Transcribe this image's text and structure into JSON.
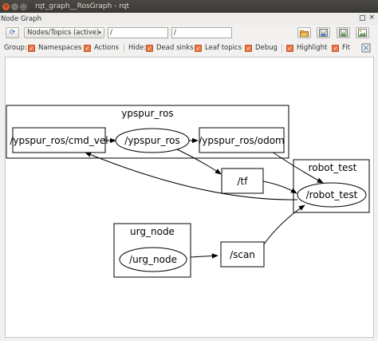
{
  "window": {
    "title": "rqt_graph__RosGraph - rqt",
    "close_glyph": "×",
    "min_glyph": "–",
    "max_glyph": "□"
  },
  "dock": {
    "title": "Node Graph"
  },
  "toolbar": {
    "refresh_glyph": "⟳",
    "mode_select": "Nodes/Topics (active)",
    "mode_arrow": "▾",
    "node_filter": "/",
    "topic_filter": "/"
  },
  "options": {
    "group_label": "Group:",
    "namespaces": {
      "label": "Namespaces",
      "checked": true
    },
    "actions": {
      "label": "Actions",
      "checked": true
    },
    "hide_label": "Hide:",
    "dead_sinks": {
      "label": "Dead sinks",
      "checked": true
    },
    "leaf_topics": {
      "label": "Leaf topics",
      "checked": true
    },
    "debug": {
      "label": "Debug",
      "checked": true
    },
    "highlight": {
      "label": "Highlight",
      "checked": true
    },
    "fit": {
      "label": "Fit",
      "checked": true
    },
    "check_glyph": "✓"
  },
  "graph": {
    "clusters": [
      {
        "id": "ypspur_ros",
        "label": "ypspur_ros"
      },
      {
        "id": "robot_test",
        "label": "robot_test"
      },
      {
        "id": "urg_node",
        "label": "urg_node"
      }
    ],
    "nodes": [
      {
        "id": "cmd_vel",
        "label": "/ypspur_ros/cmd_vel",
        "kind": "topic"
      },
      {
        "id": "ypspur_node",
        "label": "/ypspur_ros",
        "kind": "node"
      },
      {
        "id": "odom",
        "label": "/ypspur_ros/odom",
        "kind": "topic"
      },
      {
        "id": "tf",
        "label": "/tf",
        "kind": "topic"
      },
      {
        "id": "robot_test_node",
        "label": "/robot_test",
        "kind": "node"
      },
      {
        "id": "urg_node_node",
        "label": "/urg_node",
        "kind": "node"
      },
      {
        "id": "scan",
        "label": "/scan",
        "kind": "topic"
      }
    ],
    "edges": [
      {
        "from": "ypspur_ros",
        "to": "odom"
      },
      {
        "from": "cmd_vel",
        "to": "ypspur_ros"
      },
      {
        "from": "ypspur_ros",
        "to": "tf"
      },
      {
        "from": "tf",
        "to": "robot_test"
      },
      {
        "from": "odom",
        "to": "robot_test"
      },
      {
        "from": "robot_test",
        "to": "cmd_vel"
      },
      {
        "from": "urg_node",
        "to": "scan"
      },
      {
        "from": "scan",
        "to": "robot_test"
      }
    ]
  },
  "colors": {
    "titlebar": "#3c3b37",
    "checkbox_accent": "#f07746",
    "close_button": "#e05d2d",
    "canvas_bg": "#ffffff",
    "graph_ink": "#000000"
  },
  "icons": {
    "window_close": "close-icon",
    "refresh": "refresh-icon",
    "load": "folder-open-icon",
    "save": "save-icon",
    "export_image": "image-export-icon",
    "fit_view": "fit-view-icon"
  }
}
